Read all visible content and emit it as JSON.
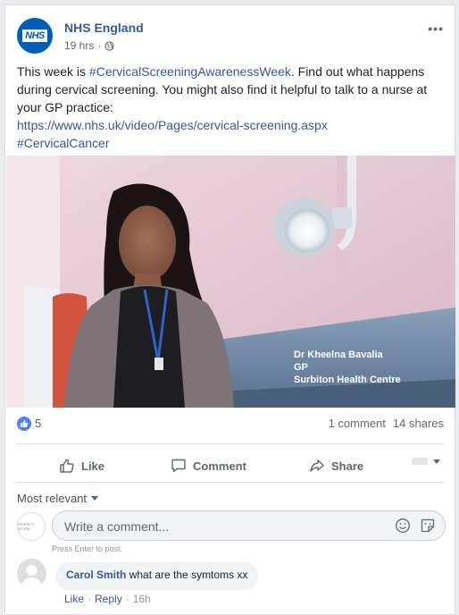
{
  "post": {
    "page_name": "NHS England",
    "logo_text": "NHS",
    "time": "19 hrs",
    "text_part1": "This week is ",
    "hashtag1": "#CervicalScreeningAwarenessWeek",
    "text_part2": ". Find out what happens during cervical screening. You might also find it helpful to talk to a nurse at your GP practice:",
    "link": "https://www.nhs.uk/video/Pages/cervical-screening.aspx",
    "hashtag2": "#CervicalCancer",
    "video_caption_name": "Dr Kheelna Bavalia",
    "video_caption_title": "GP",
    "video_caption_org": "Surbiton Health Centre"
  },
  "stats": {
    "likes": "5",
    "comments": "1 comment",
    "shares": "14 shares"
  },
  "actions": {
    "like": "Like",
    "comment": "Comment",
    "share": "Share"
  },
  "comments": {
    "sort_label": "Most relevant",
    "placeholder": "Write a comment...",
    "hint": "Press Enter to post.",
    "avatar_text": "PERFECT STORE",
    "items": [
      {
        "author": "Carol Smith",
        "text": "what are the symtoms xx",
        "like": "Like",
        "reply": "Reply",
        "time": "16h"
      }
    ]
  },
  "colors": {
    "link": "#365899",
    "nhs_blue": "#005eb8",
    "like_blue": "#4c82f7"
  }
}
